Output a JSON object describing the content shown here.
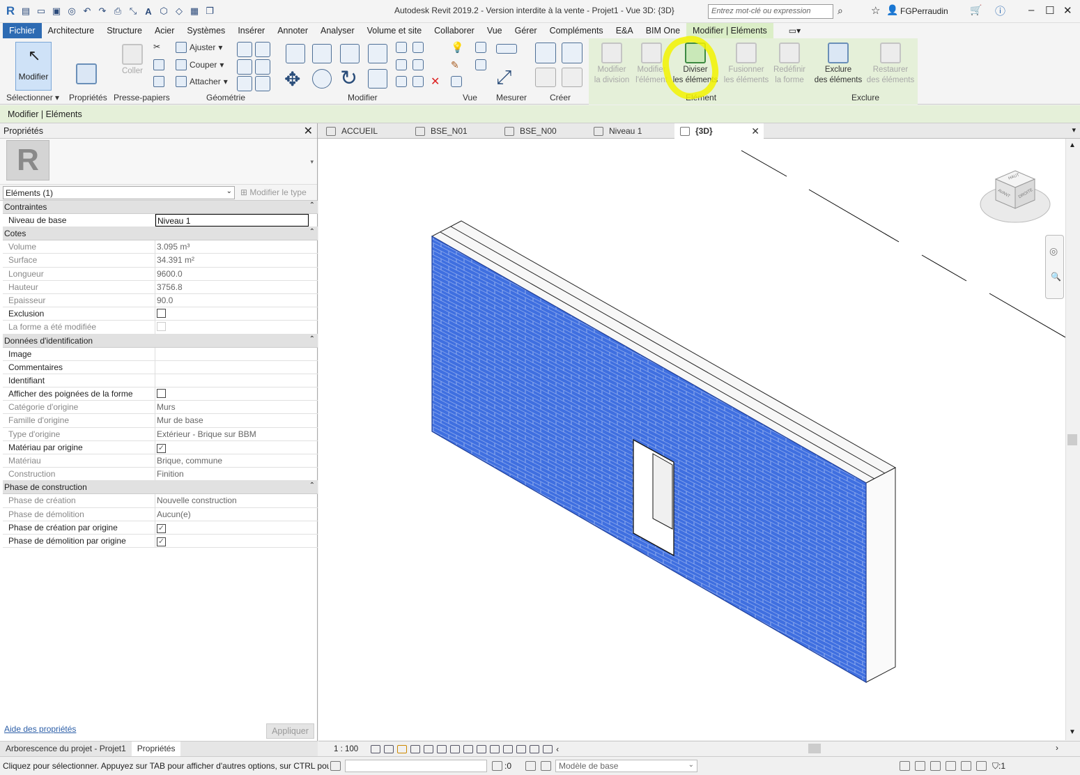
{
  "titlebar": {
    "title": "Autodesk Revit 2019.2 - Version interdite à la vente - Projet1 - Vue 3D: {3D}",
    "search_placeholder": "Entrez mot-clé ou expression",
    "user": "FGPerraudin"
  },
  "menu": {
    "items": [
      "Fichier",
      "Architecture",
      "Structure",
      "Acier",
      "Systèmes",
      "Insérer",
      "Annoter",
      "Analyser",
      "Volume et site",
      "Collaborer",
      "Vue",
      "Gérer",
      "Compléments",
      "E&A",
      "BIM One",
      "Modifier | Eléments"
    ]
  },
  "ribbon": {
    "modifier": "Modifier",
    "proprietes": "Propriétés",
    "coller": "Coller",
    "ajuster": "Ajuster",
    "couper": "Couper",
    "attacher": "Attacher",
    "panels": {
      "selectionner": "Sélectionner",
      "proprietes": "Propriétés",
      "presse_papiers": "Presse-papiers",
      "geometrie": "Géométrie",
      "modifier": "Modifier",
      "vue": "Vue",
      "mesurer": "Mesurer",
      "creer": "Créer",
      "element": "Elément",
      "exclure": "Exclure"
    },
    "element_buttons": [
      {
        "line1": "Modifier",
        "line2": "la division"
      },
      {
        "line1": "Modifier",
        "line2": "l'élément"
      },
      {
        "line1": "Diviser",
        "line2": "les éléments"
      },
      {
        "line1": "Fusionner",
        "line2": "les éléments"
      },
      {
        "line1": "Redéfinir",
        "line2": "la forme"
      },
      {
        "line1": "Exclure",
        "line2": "des éléments"
      },
      {
        "line1": "Restaurer",
        "line2": "des éléments"
      }
    ]
  },
  "context_bar": "Modifier | Eléments",
  "properties": {
    "header": "Propriétés",
    "selector": "Eléments (1)",
    "edit_type": "Modifier le type",
    "groups": [
      {
        "name": "Contraintes",
        "rows": [
          {
            "k": "Niveau de base",
            "v": "Niveau 1",
            "type": "edit"
          }
        ]
      },
      {
        "name": "Cotes",
        "rows": [
          {
            "k": "Volume",
            "v": "3.095 m³",
            "type": "dim"
          },
          {
            "k": "Surface",
            "v": "34.391 m²",
            "type": "dim"
          },
          {
            "k": "Longueur",
            "v": "9600.0",
            "type": "dim"
          },
          {
            "k": "Hauteur",
            "v": "3756.8",
            "type": "dim"
          },
          {
            "k": "Epaisseur",
            "v": "90.0",
            "type": "dim"
          },
          {
            "k": "Exclusion",
            "v": "",
            "type": "check"
          },
          {
            "k": "La forme a été modifiée",
            "v": "",
            "type": "check-dim"
          }
        ]
      },
      {
        "name": "Données d'identification",
        "rows": [
          {
            "k": "Image",
            "v": "",
            "type": "text"
          },
          {
            "k": "Commentaires",
            "v": "",
            "type": "text"
          },
          {
            "k": "Identifiant",
            "v": "",
            "type": "text"
          },
          {
            "k": "Afficher des poignées de la forme",
            "v": "",
            "type": "check"
          },
          {
            "k": "Catégorie d'origine",
            "v": "Murs",
            "type": "dim"
          },
          {
            "k": "Famille d'origine",
            "v": "Mur de base",
            "type": "dim"
          },
          {
            "k": "Type d'origine",
            "v": "Extérieur - Brique sur BBM",
            "type": "dim"
          },
          {
            "k": "Matériau par origine",
            "v": "✓",
            "type": "checked"
          },
          {
            "k": "Matériau",
            "v": "Brique, commune",
            "type": "dim"
          },
          {
            "k": "Construction",
            "v": "Finition",
            "type": "dim"
          }
        ]
      },
      {
        "name": "Phase de construction",
        "rows": [
          {
            "k": "Phase de création",
            "v": "Nouvelle construction",
            "type": "dim"
          },
          {
            "k": "Phase de démolition",
            "v": "Aucun(e)",
            "type": "dim"
          },
          {
            "k": "Phase de création par origine",
            "v": "✓",
            "type": "checked"
          },
          {
            "k": "Phase de démolition par origine",
            "v": "✓",
            "type": "checked"
          }
        ]
      }
    ],
    "help_link": "Aide des propriétés",
    "apply": "Appliquer"
  },
  "bottom_tabs": [
    "Arborescence du projet - Projet1",
    "Propriétés"
  ],
  "view_tabs": [
    "ACCUEIL",
    "BSE_N01",
    "BSE_N00",
    "Niveau 1",
    "{3D}"
  ],
  "viewcube": {
    "top": "HAUT",
    "front": "AVANT",
    "right": "DROITE"
  },
  "view_bar": {
    "scale": "1 : 100"
  },
  "status": {
    "message": "Cliquez pour sélectionner. Appuyez sur TAB pour afficher d'autres options, sur CTRL pour",
    "count": ":0",
    "model": "Modèle de base",
    "filter": ":1"
  },
  "colors": {
    "wall": "#3f6fe0",
    "context_green": "#e5f0d9",
    "highlight": "#f3f300"
  }
}
